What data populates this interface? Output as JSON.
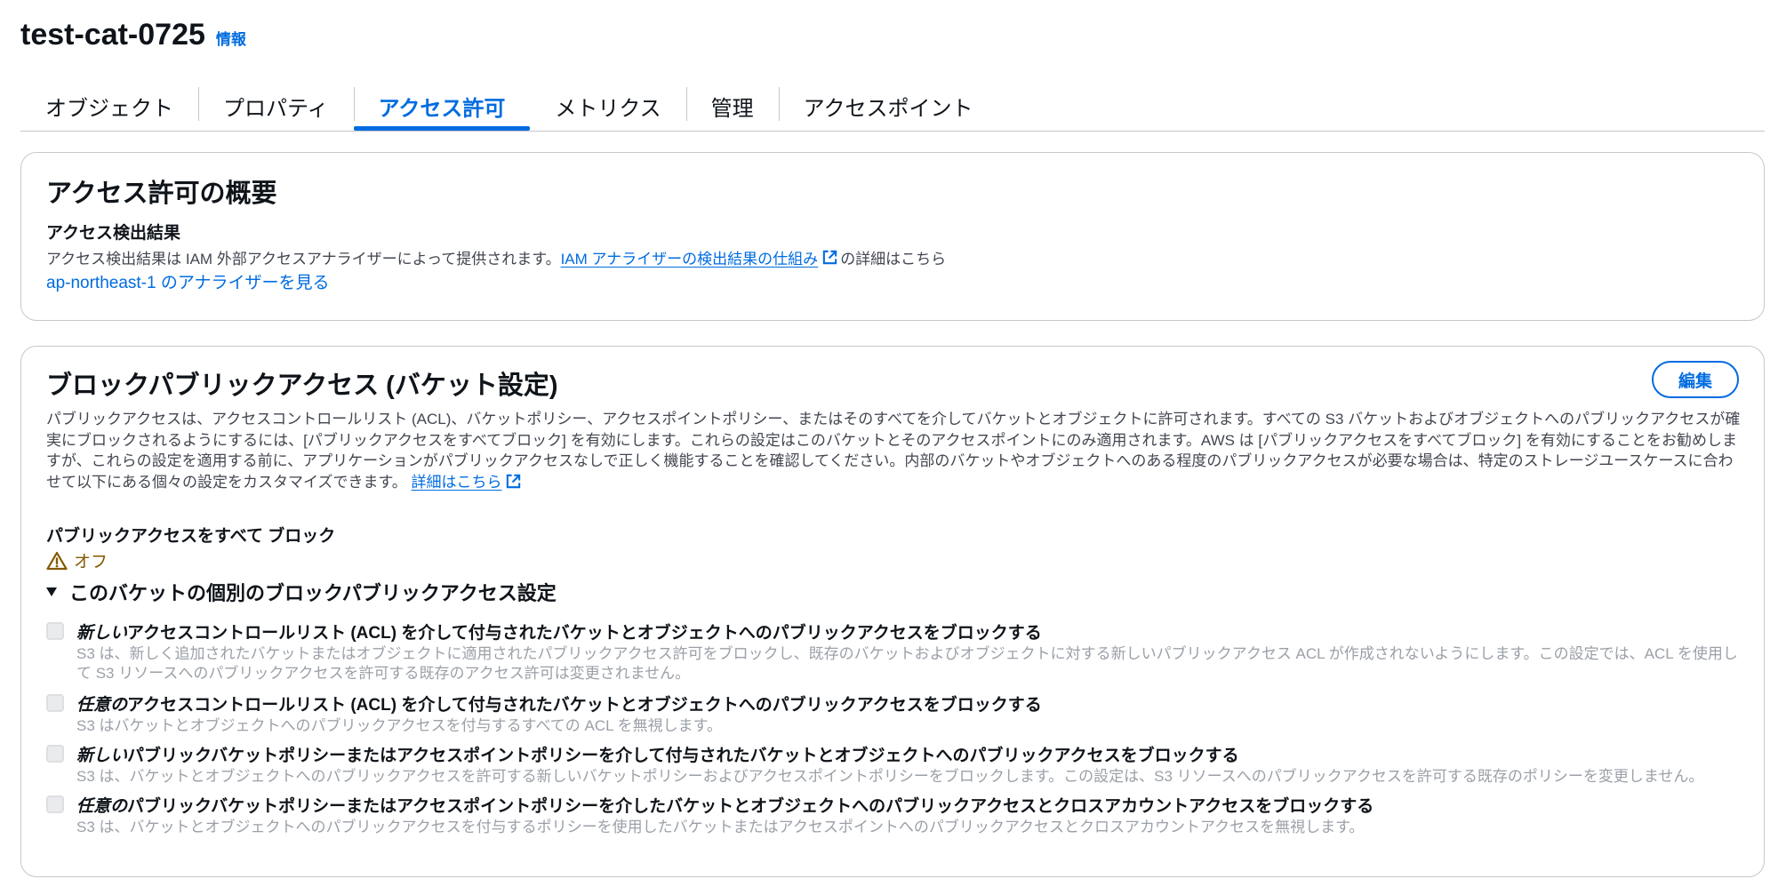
{
  "header": {
    "title": "test-cat-0725",
    "info_label": "情報"
  },
  "tabs": [
    {
      "label": "オブジェクト",
      "active": false
    },
    {
      "label": "プロパティ",
      "active": false
    },
    {
      "label": "アクセス許可",
      "active": true
    },
    {
      "label": "メトリクス",
      "active": false
    },
    {
      "label": "管理",
      "active": false
    },
    {
      "label": "アクセスポイント",
      "active": false
    }
  ],
  "overview": {
    "title": "アクセス許可の概要",
    "findings_heading": "アクセス検出結果",
    "desc_prefix": "アクセス検出結果は IAM 外部アクセスアナライザーによって提供されます。",
    "desc_link": "IAM アナライザーの検出結果の仕組み",
    "desc_suffix": "の詳細はこちら",
    "analyzer_link": "ap-northeast-1 のアナライザーを見る"
  },
  "block_public": {
    "title": "ブロックパブリックアクセス (バケット設定)",
    "edit_label": "編集",
    "description": "パブリックアクセスは、アクセスコントロールリスト (ACL)、バケットポリシー、アクセスポイントポリシー、またはそのすべてを介してバケットとオブジェクトに許可されます。すべての S3 バケットおよびオブジェクトへのパブリックアクセスが確実にブロックされるようにするには、[パブリックアクセスをすべてブロック] を有効にします。これらの設定はこのバケットとそのアクセスポイントにのみ適用されます。AWS は [パブリックアクセスをすべてブロック] を有効にすることをお勧めしますが、これらの設定を適用する前に、アプリケーションがパブリックアクセスなしで正しく機能することを確認してください。内部のバケットやオブジェクトへのある程度のパブリックアクセスが必要な場合は、特定のストレージユースケースに合わせて以下にある個々の設定をカスタマイズできます。",
    "learn_more": "詳細はこちら",
    "block_all_label": "パブリックアクセスをすべて ブロック",
    "status": "オフ",
    "status_icon": "warning-icon",
    "expander_label": "このバケットの個別のブロックパブリックアクセス設定",
    "settings": [
      {
        "emphasis": "新しい",
        "label": "アクセスコントロールリスト (ACL) を介して付与されたバケットとオブジェクトへのパブリックアクセスをブロックする",
        "description": "S3 は、新しく追加されたバケットまたはオブジェクトに適用されたパブリックアクセス許可をブロックし、既存のバケットおよびオブジェクトに対する新しいパブリックアクセス ACL が作成されないようにします。この設定では、ACL を使用して S3 リソースへのパブリックアクセスを許可する既存のアクセス許可は変更されません。",
        "checked": false
      },
      {
        "emphasis": "任意の",
        "label": "アクセスコントロールリスト (ACL) を介して付与されたバケットとオブジェクトへのパブリックアクセスをブロックする",
        "description": "S3 はバケットとオブジェクトへのパブリックアクセスを付与するすべての ACL を無視します。",
        "checked": false
      },
      {
        "emphasis": "新しい",
        "label": "パブリックバケットポリシーまたはアクセスポイントポリシーを介して付与されたバケットとオブジェクトへのパブリックアクセスをブロックする",
        "description": "S3 は、バケットとオブジェクトへのパブリックアクセスを許可する新しいバケットポリシーおよびアクセスポイントポリシーをブロックします。この設定は、S3 リソースへのパブリックアクセスを許可する既存のポリシーを変更しません。",
        "checked": false
      },
      {
        "emphasis": "任意の",
        "label": "パブリックバケットポリシーまたはアクセスポイントポリシーを介したバケットとオブジェクトへのパブリックアクセスとクロスアカウントアクセスをブロックする",
        "description": "S3 は、バケットとオブジェクトへのパブリックアクセスを付与するポリシーを使用したバケットまたはアクセスポイントへのパブリックアクセスとクロスアカウントアクセスを無視します。",
        "checked": false
      }
    ]
  },
  "colors": {
    "accent": "#006ce0",
    "warning": "#855900",
    "text": "#0f141a",
    "muted": "#424650",
    "disabled": "#9ba0a8"
  }
}
